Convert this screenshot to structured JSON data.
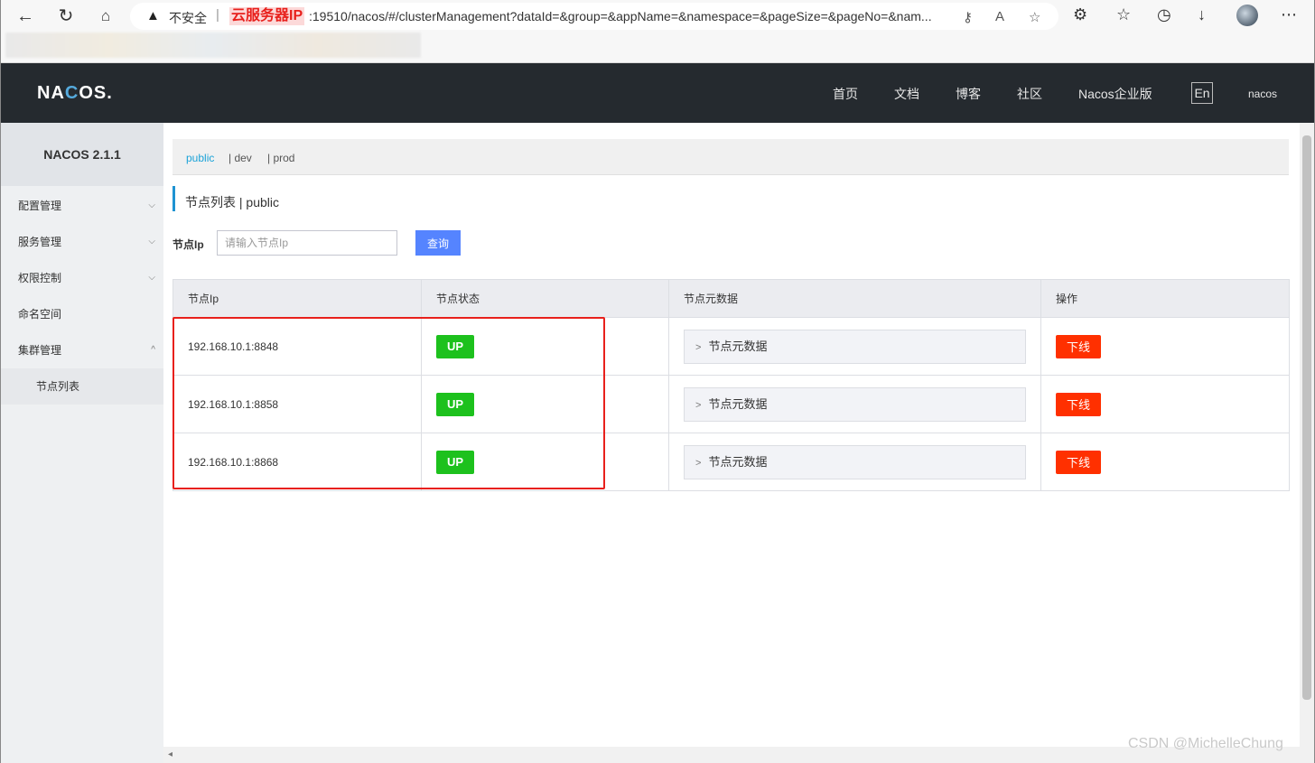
{
  "browser": {
    "insecure_label": "不安全",
    "ip_label": "云服务器IP",
    "url": ":19510/nacos/#/clusterManagement?dataId=&group=&appName=&namespace=&pageSize=&pageNo=&nam..."
  },
  "header": {
    "logo_a": "NA",
    "logo_c": "C",
    "logo_b": "OS.",
    "nav": [
      "首页",
      "文档",
      "博客",
      "社区",
      "Nacos企业版"
    ],
    "lang": "En",
    "user": "nacos"
  },
  "sidebar": {
    "title": "NACOS 2.1.1",
    "items": [
      {
        "label": "配置管理",
        "chevron": "⌵"
      },
      {
        "label": "服务管理",
        "chevron": "⌵"
      },
      {
        "label": "权限控制",
        "chevron": "⌵"
      },
      {
        "label": "命名空间"
      },
      {
        "label": "集群管理",
        "chevron": "^"
      },
      {
        "label": "节点列表"
      }
    ]
  },
  "namespaces": [
    "public",
    "| dev",
    "| prod"
  ],
  "page": {
    "title": "节点列表  |  public"
  },
  "filter": {
    "label": "节点Ip",
    "placeholder": "请输入节点Ip",
    "button": "查询"
  },
  "table": {
    "headers": [
      "节点Ip",
      "节点状态",
      "节点元数据",
      "操作"
    ],
    "rows": [
      {
        "ip": "192.168.10.1:8848",
        "status": "UP",
        "meta": "节点元数据",
        "action": "下线"
      },
      {
        "ip": "192.168.10.1:8858",
        "status": "UP",
        "meta": "节点元数据",
        "action": "下线"
      },
      {
        "ip": "192.168.10.1:8868",
        "status": "UP",
        "meta": "节点元数据",
        "action": "下线"
      }
    ]
  },
  "watermark": "CSDN @MichelleChung",
  "colors": {
    "header_bg": "#252a2f",
    "accent": "#1ba3d8",
    "primary_btn": "#5584ff",
    "status_up": "#1dc11d",
    "danger": "#ff3000",
    "highlight": "#e8201c"
  }
}
